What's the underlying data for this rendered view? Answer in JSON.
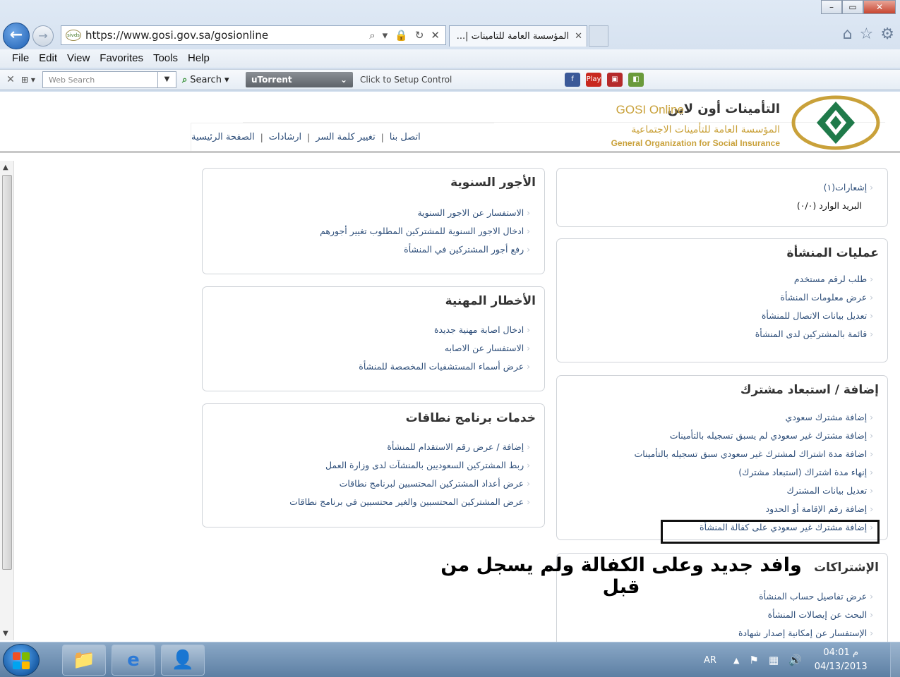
{
  "browser": {
    "url": "https://www.gosi.gov.sa/gosionline",
    "tab_title": "المؤسسة العامة للتأمينات |...",
    "favicon_text": "sivds",
    "menu": [
      "File",
      "Edit",
      "View",
      "Favorites",
      "Tools",
      "Help"
    ],
    "web_search_placeholder": "Web Search",
    "search_label": "Search",
    "utorrent_label": "uTorrent",
    "setup_label": "Click to Setup Control",
    "play_label": "Play"
  },
  "site": {
    "logo_en": "GOSI Online",
    "logo_ar": "التأمينات أون لاين",
    "org_ar": "المؤسسة العامة للتأمينات الاجتماعية",
    "org_en": "General Organization for Social Insurance",
    "nav": [
      "الصفحة الرئيسية",
      "ارشادات",
      "تغيير كلمة السر",
      "اتصل بنا"
    ],
    "nav_sep": "|"
  },
  "panels": {
    "notifications": {
      "items": [
        "إشعارات(١)"
      ],
      "inbox": "البريد الوارد (٠/٠)"
    },
    "establishment": {
      "title": "عمليات المنشأة",
      "items": [
        "طلب لرقم مستخدم",
        "عرض معلومات المنشأة",
        "تعديل بيانات الاتصال للمنشأة",
        "قائمة بالمشتركين لدى المنشأة"
      ]
    },
    "add_remove": {
      "title": "إضافة / استبعاد مشترك",
      "items": [
        "إضافة مشترك سعودي",
        "إضافة مشترك غير سعودي لم يسبق تسجيله بالتأمينات",
        "اضافة مدة اشتراك لمشترك غير سعودي سبق تسجيله بالتأمينات",
        "إنهاء مدة اشتراك (استبعاد مشترك)",
        "تعديل بيانات المشترك",
        "إضافة رقم الإقامة أو الحدود",
        "إضافة مشترك غير سعودي على كفالة المنشأة"
      ]
    },
    "subscriptions": {
      "title": "الإشتراكات",
      "items": [
        "عرض تفاصيل حساب المنشأة",
        "البحث عن إيصالات المنشأة",
        "الإستفسار عن إمكانية إصدار شهادة"
      ]
    },
    "annual_wages": {
      "title": "الأجور السنوية",
      "items": [
        "الاستفسار عن الاجور السنوية",
        "ادخال الاجور السنوية للمشتركين المطلوب تغيير أجورهم",
        "رفع أجور المشتركين في المنشأة"
      ]
    },
    "occupational": {
      "title": "الأخطار المهنية",
      "items": [
        "ادخال اصابة مهنية جديدة",
        "الاستفسار عن الاصابه",
        "عرض أسماء المستشفيات المخصصة للمنشأة"
      ]
    },
    "nitaqat": {
      "title": "خدمات برنامج نطاقات",
      "items": [
        "إضافة / عرض رقم الاستقدام للمنشأة",
        "ربط المشتركين السعوديين بالمنشآت لدى وزارة العمل",
        "عرض أعداد المشتركين المحتسبين لبرنامج نطاقات",
        "عرض المشتركين المحتسبين والغير محتسبين في برنامج نطاقات"
      ]
    }
  },
  "annotation": "وافد جديد وعلى الكفالة ولم يسجل من قبل",
  "taskbar": {
    "lang": "AR",
    "time": "04:01 م",
    "date": "04/13/2013"
  }
}
